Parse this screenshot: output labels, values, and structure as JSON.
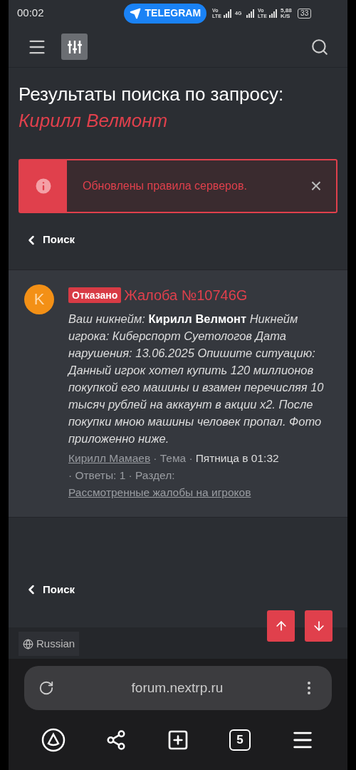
{
  "status_bar": {
    "time": "00:02",
    "notification": "TELEGRAM",
    "network_labels": [
      "Vo LTE",
      "4G",
      "Vo LTE"
    ],
    "speed": "5,88",
    "speed_unit": "K/S",
    "battery": "33"
  },
  "title": {
    "prefix": "Результаты поиска по запросу:",
    "query": "Кирилл Велмонт"
  },
  "notice": {
    "text": "Обновлены правила серверов.",
    "close": "×"
  },
  "back_links": [
    "Поиск",
    "Поиск"
  ],
  "results": [
    {
      "avatar_letter": "K",
      "status": "Отказано",
      "title": "Жалоба №10746G",
      "snippet": "Ваш никнейм: **Кирилл Велмонт** Никнейм игрока: Киберспорт Суетологов Дата нарушения: 13.06.2025 Опишите ситуацию: Данный игрок хотел купить 120 миллионов покупкой его машины и взамен перечисляя 10 тысяч рублей на аккаунт в акции x2. После покупки мною машины человек пропал. Фото приложенно ниже.",
      "author": "Кирилл Мамаев",
      "type": "· Тема ·",
      "date": "Пятница в 01:32",
      "replies": "· Ответы: 1 · Раздел:",
      "section": "Рассмотренные жалобы на игроков"
    }
  ],
  "language": "Russian",
  "browser": {
    "url": "forum.nextrp.ru",
    "tab_count": "5"
  }
}
